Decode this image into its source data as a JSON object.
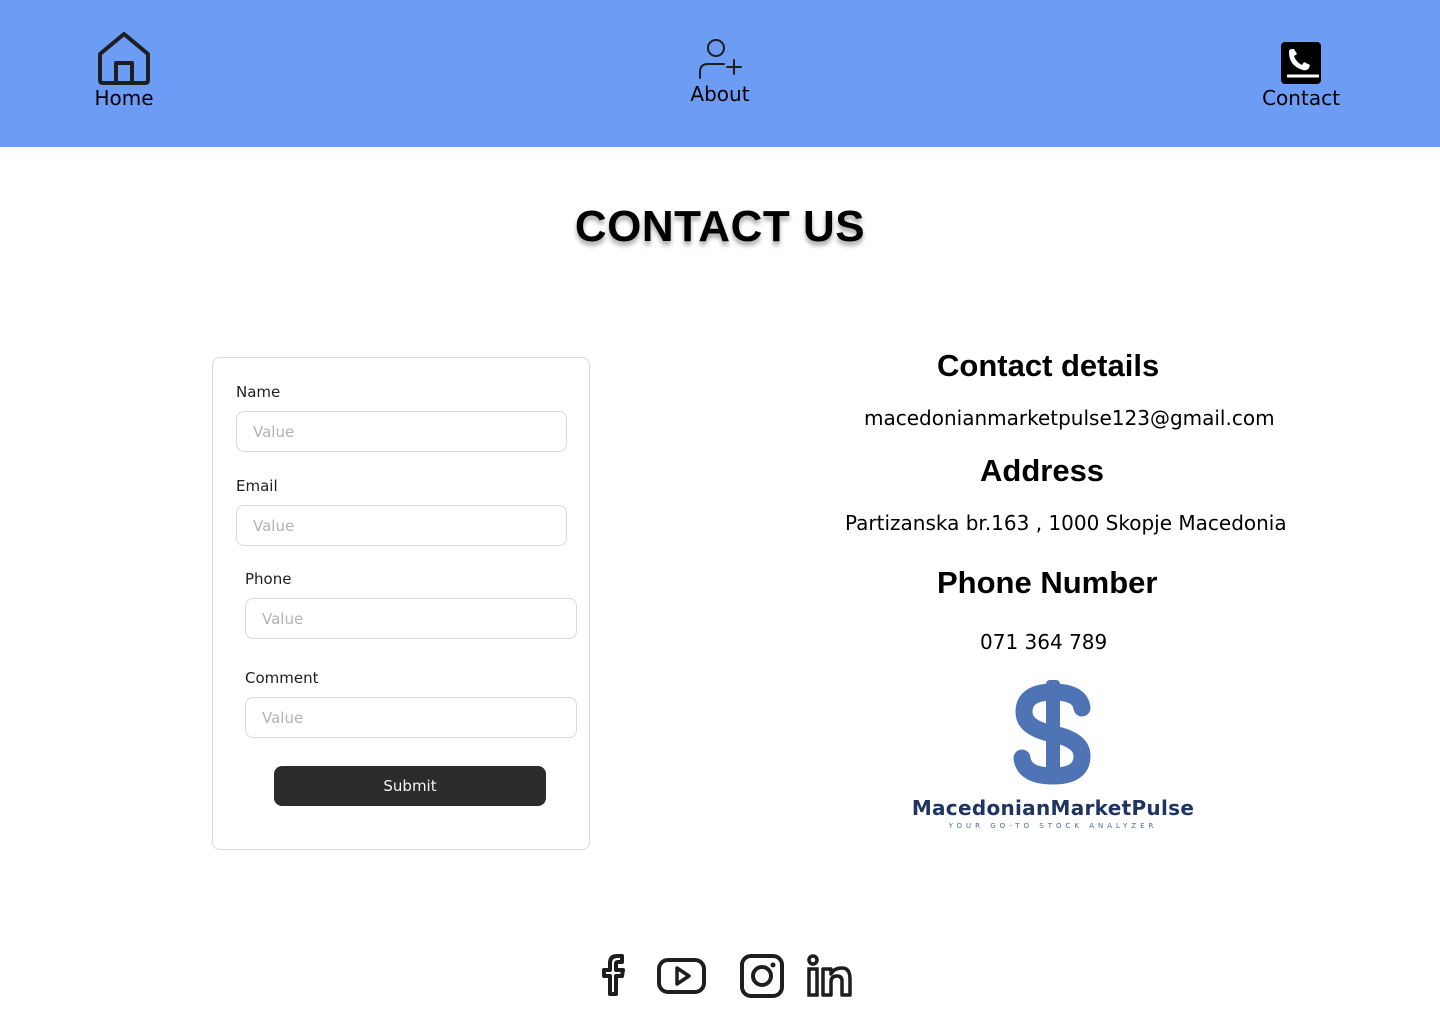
{
  "nav": {
    "home_label": "Home",
    "about_label": "About",
    "contact_label": "Contact",
    "background": "#6d9cf5"
  },
  "page": {
    "title": "CONTACT US"
  },
  "form": {
    "name_label": "Name",
    "name_placeholder": "Value",
    "email_label": "Email",
    "email_placeholder": "Value",
    "phone_label": "Phone",
    "phone_placeholder": "Value",
    "comment_label": "Comment",
    "comment_placeholder": "Value",
    "submit_label": "Submit"
  },
  "details": {
    "contact_heading": "Contact details",
    "email": "macedonianmarketpulse123@gmail.com",
    "address_heading": "Address",
    "address": "Partizanska br.163 , 1000 Skopje Macedonia",
    "phone_heading": "Phone Number",
    "phone": "071 364 789"
  },
  "logo": {
    "brand": "MacedonianMarketPulse",
    "tagline": "YOUR GO-TO STOCK ANALYZER",
    "color": "#4f74b5"
  },
  "socials": {
    "icons": [
      "facebook-icon",
      "youtube-icon",
      "instagram-icon",
      "linkedin-icon"
    ]
  }
}
